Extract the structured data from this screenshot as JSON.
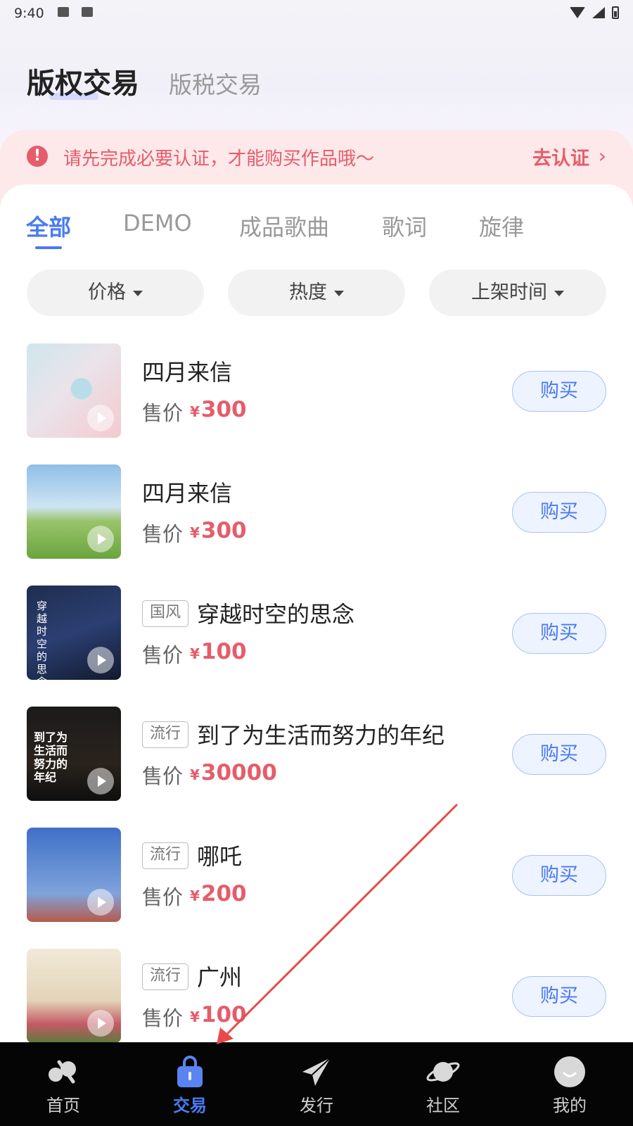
{
  "status_bar": {
    "time": "9:40"
  },
  "header": {
    "title": "版权交易",
    "subtitle": "版税交易"
  },
  "alert": {
    "text": "请先完成必要认证，才能购买作品哦～",
    "link": "去认证"
  },
  "tabs": [
    {
      "label": "全部",
      "active": true
    },
    {
      "label": "DEMO"
    },
    {
      "label": "成品歌曲"
    },
    {
      "label": "歌词"
    },
    {
      "label": "旋律"
    }
  ],
  "filters": [
    {
      "label": "价格"
    },
    {
      "label": "热度"
    },
    {
      "label": "上架时间"
    }
  ],
  "items": [
    {
      "title": "四月来信",
      "tag": "",
      "price_label": "售价",
      "currency": "¥",
      "price": "300",
      "button": "购买"
    },
    {
      "title": "四月来信",
      "tag": "",
      "price_label": "售价",
      "currency": "¥",
      "price": "300",
      "button": "购买"
    },
    {
      "title": "穿越时空的思念",
      "tag": "国风",
      "price_label": "售价",
      "currency": "¥",
      "price": "100",
      "button": "购买"
    },
    {
      "title": "到了为生活而努力的年纪",
      "tag": "流行",
      "price_label": "售价",
      "currency": "¥",
      "price": "30000",
      "button": "购买"
    },
    {
      "title": "哪吒",
      "tag": "流行",
      "price_label": "售价",
      "currency": "¥",
      "price": "200",
      "button": "购买"
    },
    {
      "title": "广州",
      "tag": "流行",
      "price_label": "售价",
      "currency": "¥",
      "price": "100",
      "button": "购买"
    }
  ],
  "thumb_text": {
    "item3": "穿越时空的思念",
    "item4": "到了为生活而努力的年纪"
  },
  "bottom_nav": [
    {
      "label": "首页",
      "icon": "home-icon"
    },
    {
      "label": "交易",
      "icon": "bag-icon",
      "active": true
    },
    {
      "label": "发行",
      "icon": "paper-plane-icon"
    },
    {
      "label": "社区",
      "icon": "planet-icon"
    },
    {
      "label": "我的",
      "icon": "smiley-icon"
    }
  ],
  "colors": {
    "accent": "#4a7af2",
    "price": "#e55d6a",
    "alert_bg": "#fde8ea",
    "nav_bg": "#050505",
    "annotation_arrow": "#e84a4a"
  }
}
